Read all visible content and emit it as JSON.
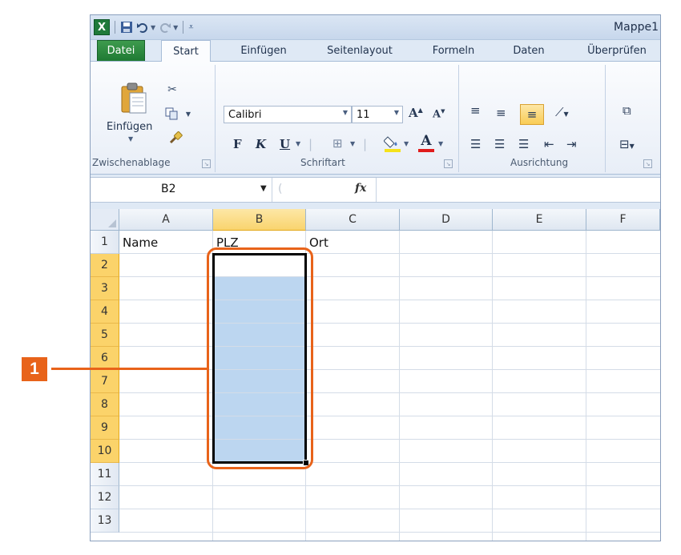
{
  "window": {
    "title": "Mappe1"
  },
  "quick_access": {
    "app_icon": "excel-icon",
    "save_icon": "save-icon",
    "undo_icon": "undo-icon",
    "redo_icon": "redo-icon",
    "customize_icon": "customize-qat-icon"
  },
  "tabs": [
    {
      "label": "Datei"
    },
    {
      "label": "Start"
    },
    {
      "label": "Einfügen"
    },
    {
      "label": "Seitenlayout"
    },
    {
      "label": "Formeln"
    },
    {
      "label": "Daten"
    },
    {
      "label": "Überprüfen"
    }
  ],
  "ribbon": {
    "clipboard": {
      "paste_label": "Einfügen",
      "group_label": "Zwischenablage"
    },
    "font": {
      "font_name": "Calibri",
      "font_size": "11",
      "bold_label": "F",
      "italic_label": "K",
      "underline_label": "U",
      "group_label": "Schriftart"
    },
    "alignment": {
      "group_label": "Ausrichtung"
    }
  },
  "formula_bar": {
    "name_box": "B2",
    "fx_label": "fx",
    "formula": ""
  },
  "sheet": {
    "columns": [
      "A",
      "B",
      "C",
      "D",
      "E",
      "F"
    ],
    "rows": [
      "1",
      "2",
      "3",
      "4",
      "5",
      "6",
      "7",
      "8",
      "9",
      "10",
      "11",
      "12",
      "13"
    ],
    "cells": {
      "A1": "Name",
      "B1": "PLZ",
      "C1": "Ort"
    },
    "selected_column": "B",
    "selected_range": "B2:B10"
  },
  "callout": {
    "number": "1"
  },
  "colors": {
    "accent": "#e8631a",
    "selection": "#bcd6f0",
    "header_selected": "#fbd36a",
    "file_tab": "#1f7a33"
  }
}
